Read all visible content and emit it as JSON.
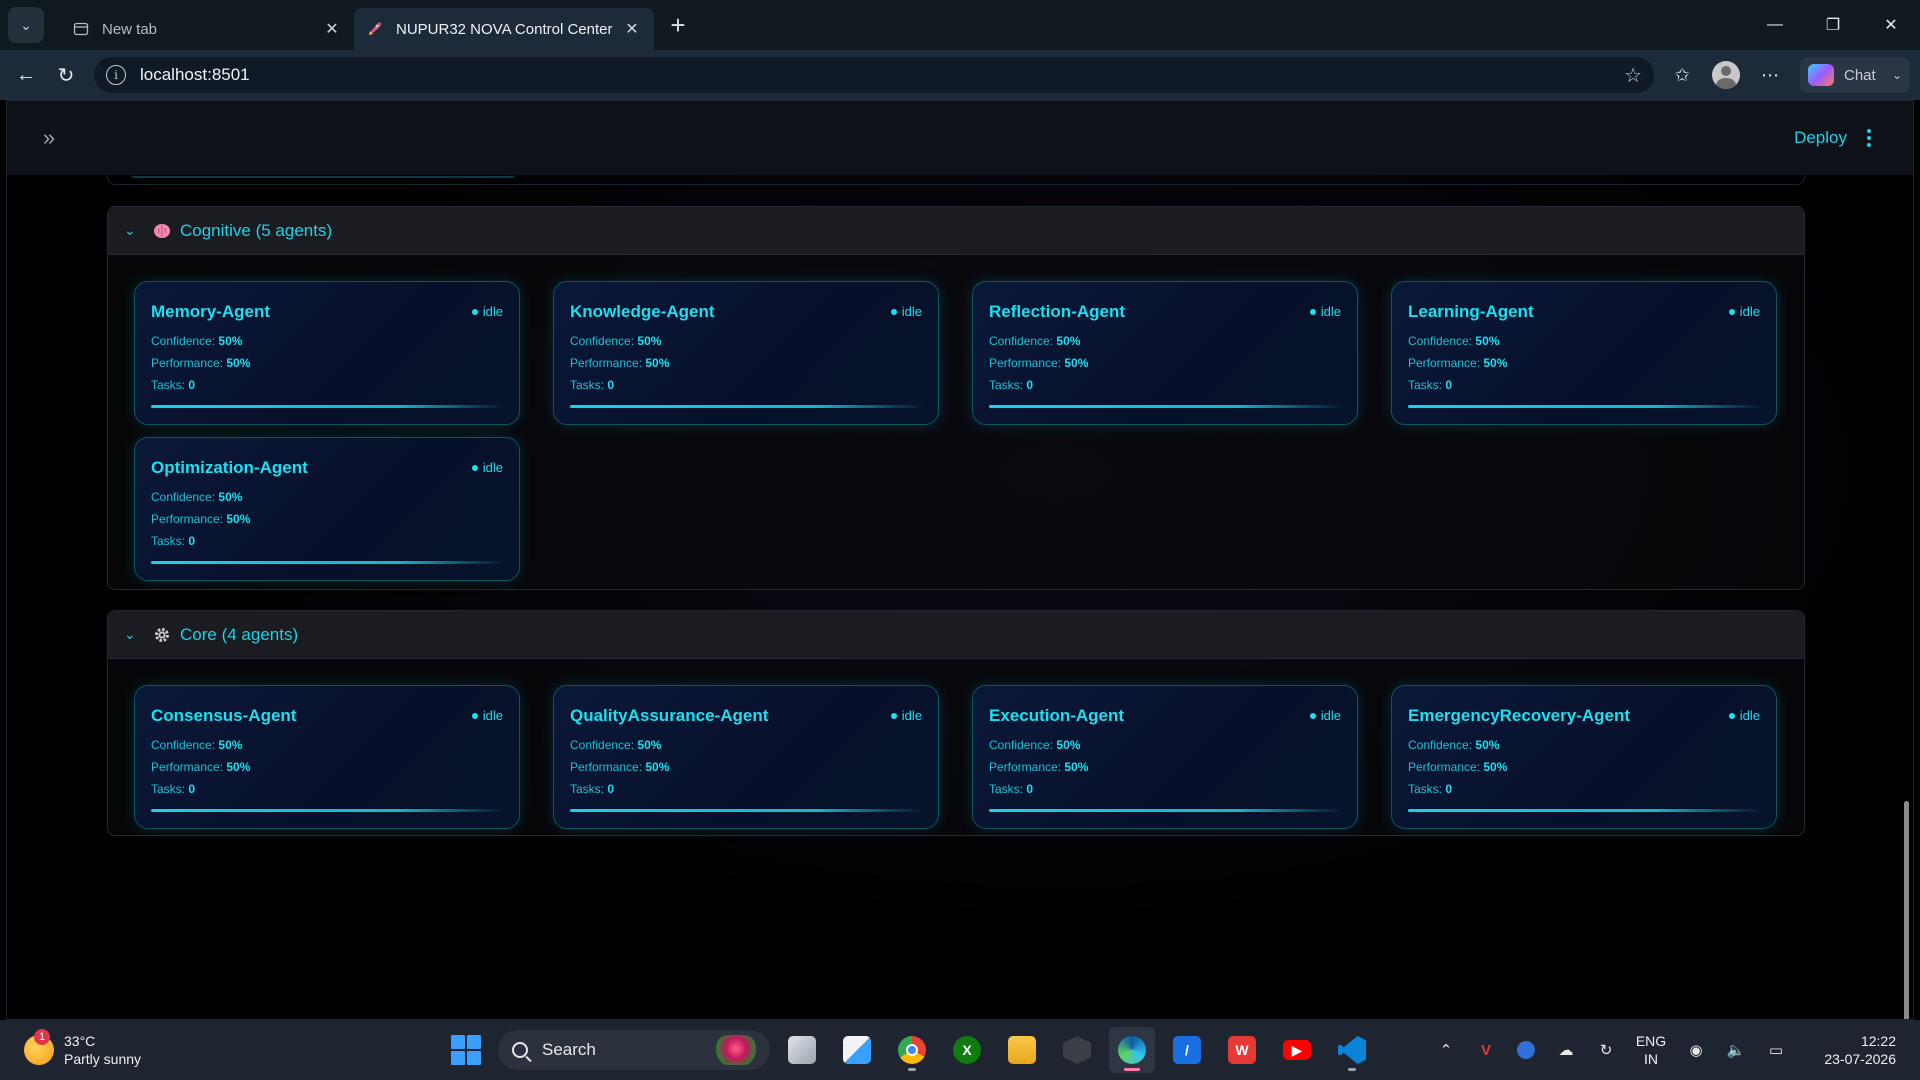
{
  "browser": {
    "tabs": [
      {
        "title": "New tab",
        "icon": "page-icon",
        "active": false
      },
      {
        "title": "NUPUR32 NOVA Control Center",
        "icon": "rocket-icon",
        "active": true
      }
    ],
    "url": "localhost:8501",
    "chat_label": "Chat"
  },
  "app": {
    "deploy_label": "Deploy"
  },
  "groups": [
    {
      "title": "Cognitive (5 agents)",
      "icon": "brain-icon",
      "agents": [
        {
          "name": "Memory-Agent",
          "status": "idle",
          "confidence_label": "Confidence:",
          "confidence": "50%",
          "performance_label": "Performance:",
          "performance": "50%",
          "tasks_label": "Tasks:",
          "tasks": "0"
        },
        {
          "name": "Knowledge-Agent",
          "status": "idle",
          "confidence_label": "Confidence:",
          "confidence": "50%",
          "performance_label": "Performance:",
          "performance": "50%",
          "tasks_label": "Tasks:",
          "tasks": "0"
        },
        {
          "name": "Reflection-Agent",
          "status": "idle",
          "confidence_label": "Confidence:",
          "confidence": "50%",
          "performance_label": "Performance:",
          "performance": "50%",
          "tasks_label": "Tasks:",
          "tasks": "0"
        },
        {
          "name": "Learning-Agent",
          "status": "idle",
          "confidence_label": "Confidence:",
          "confidence": "50%",
          "performance_label": "Performance:",
          "performance": "50%",
          "tasks_label": "Tasks:",
          "tasks": "0"
        },
        {
          "name": "Optimization-Agent",
          "status": "idle",
          "confidence_label": "Confidence:",
          "confidence": "50%",
          "performance_label": "Performance:",
          "performance": "50%",
          "tasks_label": "Tasks:",
          "tasks": "0"
        }
      ]
    },
    {
      "title": "Core (4 agents)",
      "icon": "gear-icon",
      "agents": [
        {
          "name": "Consensus-Agent",
          "status": "idle",
          "confidence_label": "Confidence:",
          "confidence": "50%",
          "performance_label": "Performance:",
          "performance": "50%",
          "tasks_label": "Tasks:",
          "tasks": "0"
        },
        {
          "name": "QualityAssurance-Agent",
          "status": "idle",
          "confidence_label": "Confidence:",
          "confidence": "50%",
          "performance_label": "Performance:",
          "performance": "50%",
          "tasks_label": "Tasks:",
          "tasks": "0"
        },
        {
          "name": "Execution-Agent",
          "status": "idle",
          "confidence_label": "Confidence:",
          "confidence": "50%",
          "performance_label": "Performance:",
          "performance": "50%",
          "tasks_label": "Tasks:",
          "tasks": "0"
        },
        {
          "name": "EmergencyRecovery-Agent",
          "status": "idle",
          "confidence_label": "Confidence:",
          "confidence": "50%",
          "performance_label": "Performance:",
          "performance": "50%",
          "tasks_label": "Tasks:",
          "tasks": "0"
        }
      ]
    }
  ],
  "taskbar": {
    "weather_temp": "33°C",
    "weather_desc": "Partly sunny",
    "weather_badge": "1",
    "search_label": "Search",
    "lang_line1": "ENG",
    "lang_line2": "IN",
    "time": "12:22",
    "date": "23-07-2026"
  },
  "colors": {
    "accent": "#1ad3e6",
    "card_border": "#0d5563",
    "background": "#000000"
  }
}
